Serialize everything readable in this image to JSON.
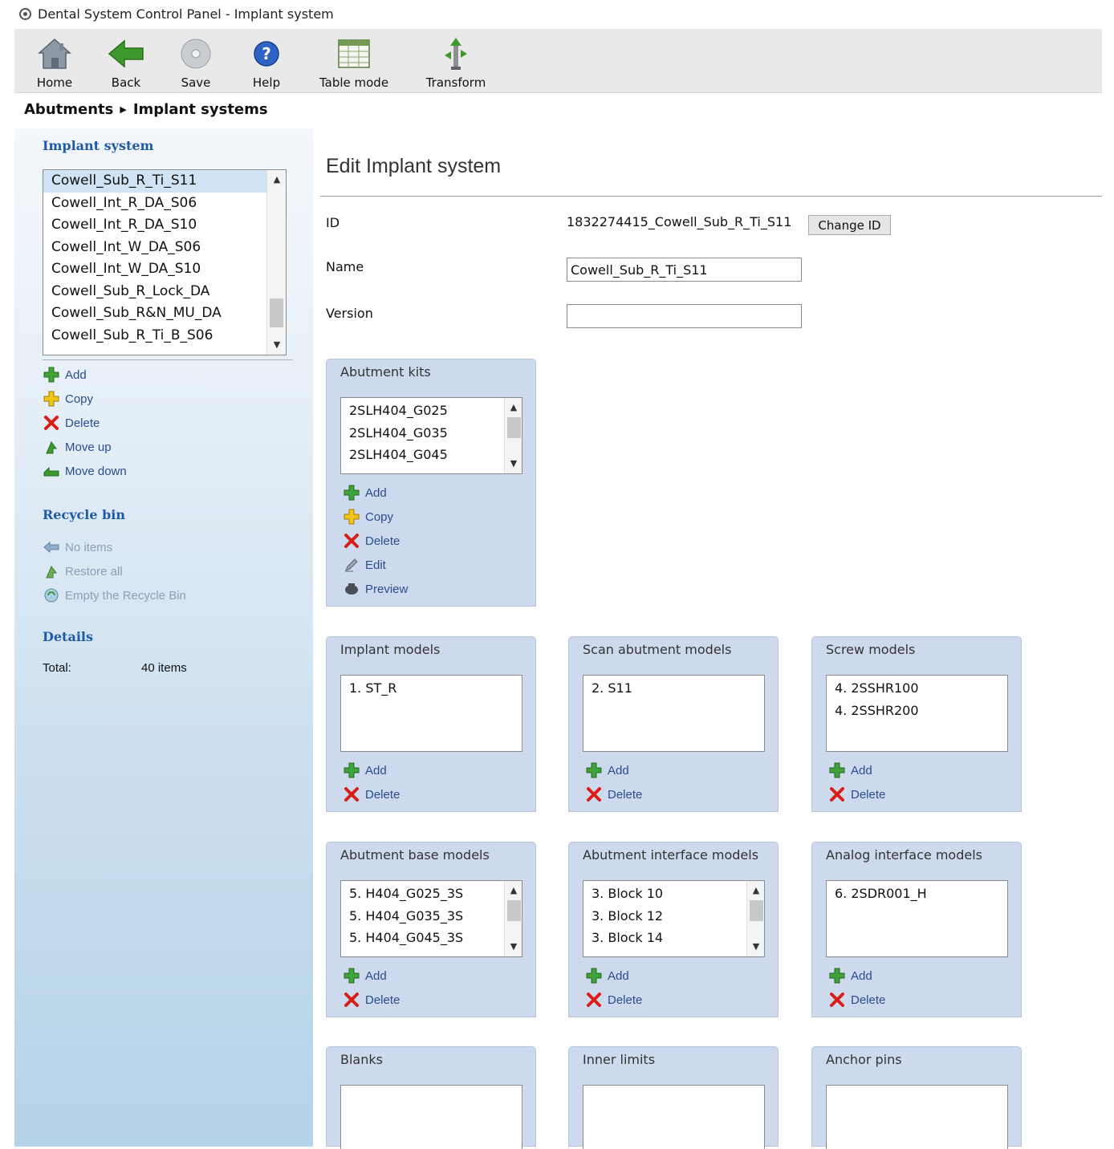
{
  "window": {
    "title": "Dental System Control Panel - Implant system"
  },
  "toolbar": {
    "home": "Home",
    "back": "Back",
    "save": "Save",
    "help": "Help",
    "table_mode": "Table mode",
    "transform": "Transform"
  },
  "breadcrumb": {
    "level1": "Abutments",
    "level2": "Implant systems"
  },
  "sidebar": {
    "implant_system_heading": "Implant system",
    "systems": [
      "Cowell_Sub_R_Ti_S11",
      "Cowell_Int_R_DA_S06",
      "Cowell_Int_R_DA_S10",
      "Cowell_Int_W_DA_S06",
      "Cowell_Int_W_DA_S10",
      "Cowell_Sub_R_Lock_DA",
      "Cowell_Sub_R&N_MU_DA",
      "Cowell_Sub_R_Ti_B_S06"
    ],
    "selected_system": "Cowell_Sub_R_Ti_S11",
    "actions": {
      "add": "Add",
      "copy": "Copy",
      "delete": "Delete",
      "move_up": "Move up",
      "move_down": "Move down"
    },
    "recycle_bin_heading": "Recycle bin",
    "recycle": {
      "no_items": "No items",
      "restore_all": "Restore all",
      "empty": "Empty the Recycle Bin"
    },
    "details_heading": "Details",
    "details": {
      "total_label": "Total:",
      "total_value": "40 items"
    }
  },
  "main": {
    "title": "Edit Implant system",
    "id_label": "ID",
    "id_value": "1832274415_Cowell_Sub_R_Ti_S11",
    "change_id_label": "Change ID",
    "name_label": "Name",
    "name_value": "Cowell_Sub_R_Ti_S11",
    "version_label": "Version",
    "version_value": ""
  },
  "panels": {
    "abutment_kits": {
      "title": "Abutment kits",
      "items": [
        "2SLH404_G025",
        "2SLH404_G035",
        "2SLH404_G045"
      ],
      "actions": {
        "add": "Add",
        "copy": "Copy",
        "delete": "Delete",
        "edit": "Edit",
        "preview": "Preview"
      }
    },
    "implant_models": {
      "title": "Implant models",
      "items": [
        "1. ST_R"
      ],
      "actions": {
        "add": "Add",
        "delete": "Delete"
      }
    },
    "scan_abutment_models": {
      "title": "Scan abutment models",
      "items": [
        "2. S11"
      ],
      "actions": {
        "add": "Add",
        "delete": "Delete"
      }
    },
    "screw_models": {
      "title": "Screw models",
      "items": [
        "4. 2SSHR100",
        "4. 2SSHR200"
      ],
      "actions": {
        "add": "Add",
        "delete": "Delete"
      }
    },
    "abutment_base_models": {
      "title": "Abutment base models",
      "items": [
        "5. H404_G025_3S",
        "5. H404_G035_3S",
        "5. H404_G045_3S"
      ],
      "actions": {
        "add": "Add",
        "delete": "Delete"
      }
    },
    "abutment_interface_models": {
      "title": "Abutment interface models",
      "items": [
        "3. Block 10",
        "3. Block 12",
        "3. Block 14"
      ],
      "actions": {
        "add": "Add",
        "delete": "Delete"
      }
    },
    "analog_interface_models": {
      "title": "Analog interface models",
      "items": [
        "6. 2SDR001_H"
      ],
      "actions": {
        "add": "Add",
        "delete": "Delete"
      }
    },
    "blanks": {
      "title": "Blanks"
    },
    "inner_limits": {
      "title": "Inner limits"
    },
    "anchor_pins": {
      "title": "Anchor pins"
    }
  },
  "colors": {
    "sidebar_heading": "#1e5aa8",
    "link": "#2a4d8f",
    "selected_row": "#cfe3f5",
    "panel_bg": "#cddaed"
  }
}
